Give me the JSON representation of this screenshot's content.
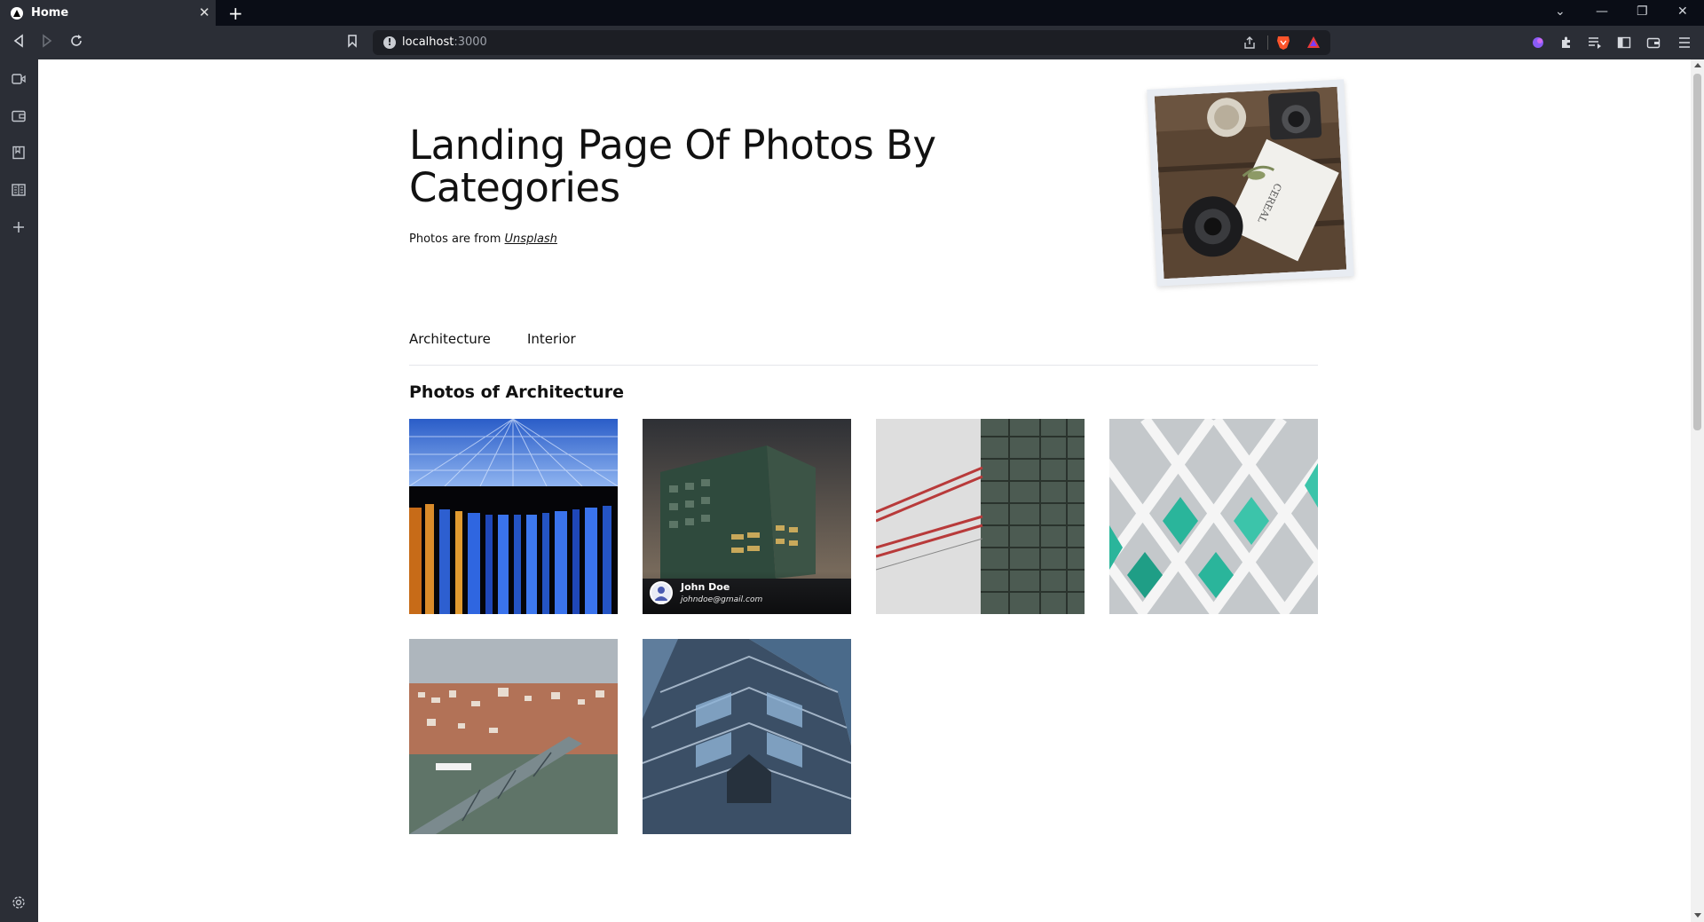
{
  "browser": {
    "tab_title": "Home",
    "url_host": "localhost",
    "url_port": ":3000"
  },
  "page": {
    "title": "Landing Page Of Photos By Categories",
    "subtitle_prefix": "Photos are from",
    "subtitle_link": "Unsplash",
    "categories": [
      "Architecture",
      "Interior"
    ],
    "active_category": "Architecture",
    "section_title": "Photos of Architecture"
  },
  "photos": [
    {
      "name": "blue-glass-facade"
    },
    {
      "name": "norwid-building",
      "author": "John Doe",
      "email": "johndoe@gmail.com"
    },
    {
      "name": "crane-glass-building"
    },
    {
      "name": "diamond-lattice-windows"
    },
    {
      "name": "porto-bridge-city"
    },
    {
      "name": "angular-glass-building"
    }
  ],
  "icons": [
    "back-icon",
    "forward-icon",
    "reload-icon",
    "bookmark-icon",
    "share-icon",
    "brave-icon",
    "extensions-icon",
    "menu-icon",
    "settings-icon"
  ]
}
